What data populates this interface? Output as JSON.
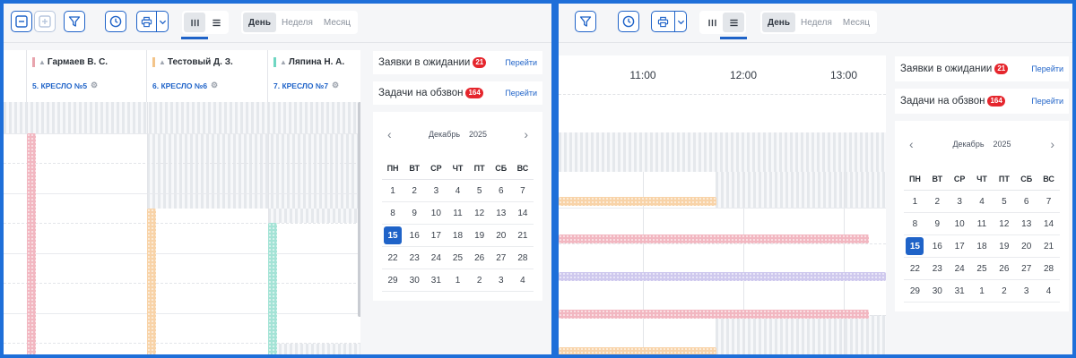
{
  "toolbar": {
    "view_modes": [
      "columns-icon",
      "list-icon"
    ],
    "periods": [
      "День",
      "Неделя",
      "Месяц"
    ],
    "active_period": "День"
  },
  "sidebar": {
    "waiting": {
      "label": "Заявки в ожидании",
      "count": "21",
      "action": "Перейти"
    },
    "calls": {
      "label": "Задачи на обзвон",
      "count": "164",
      "action": "Перейти"
    }
  },
  "calendar": {
    "month": "Декабрь",
    "year": "2025",
    "weekdays": [
      "ПН",
      "ВТ",
      "СР",
      "ЧТ",
      "ПТ",
      "СБ",
      "ВС"
    ],
    "weeks": [
      [
        "1",
        "2",
        "3",
        "4",
        "5",
        "6",
        "7"
      ],
      [
        "8",
        "9",
        "10",
        "11",
        "12",
        "13",
        "14"
      ],
      [
        "15",
        "16",
        "17",
        "18",
        "19",
        "20",
        "21"
      ],
      [
        "22",
        "23",
        "24",
        "25",
        "26",
        "27",
        "28"
      ],
      [
        "29",
        "30",
        "31",
        "1",
        "2",
        "3",
        "4"
      ]
    ],
    "selected": "15"
  },
  "doctors": [
    {
      "name": "Гармаев В. С.",
      "chair": "5. КРЕСЛО №5",
      "color": "#e8a4ad"
    },
    {
      "name": "Тестовый Д. З.",
      "chair": "6. КРЕСЛО №6",
      "color": "#f3c489"
    },
    {
      "name": "Ляпина Н. А.",
      "chair": "7. КРЕСЛО №7",
      "color": "#6fd6c2"
    }
  ],
  "timeline": {
    "hours": [
      "11:00",
      "12:00",
      "13:00"
    ]
  },
  "colors": {
    "accent": "#1f63c8",
    "badge": "#e5262d",
    "appt_pink": "#f2b7c1",
    "appt_orange": "#f8d3a8",
    "appt_teal": "#a4e3d6",
    "appt_purple": "#cfc9ee"
  }
}
